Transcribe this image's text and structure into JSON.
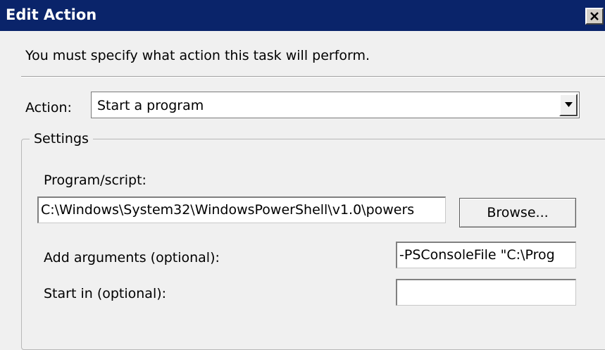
{
  "window": {
    "title": "Edit Action",
    "close_glyph": "close-icon"
  },
  "instruction": "You must specify what action this task will perform.",
  "action": {
    "label": "Action:",
    "selected": "Start a program"
  },
  "settings": {
    "legend": "Settings",
    "program_label": "Program/script:",
    "program_value": "C:\\Windows\\System32\\WindowsPowerShell\\v1.0\\powers",
    "browse_label": "Browse...",
    "arguments_label": "Add arguments (optional):",
    "arguments_value": "-PSConsoleFile \"C:\\Prog",
    "start_in_label": "Start in (optional):",
    "start_in_value": ""
  },
  "colors": {
    "titlebar": "#0a246a",
    "dialog_bg": "#f0f0f0"
  }
}
